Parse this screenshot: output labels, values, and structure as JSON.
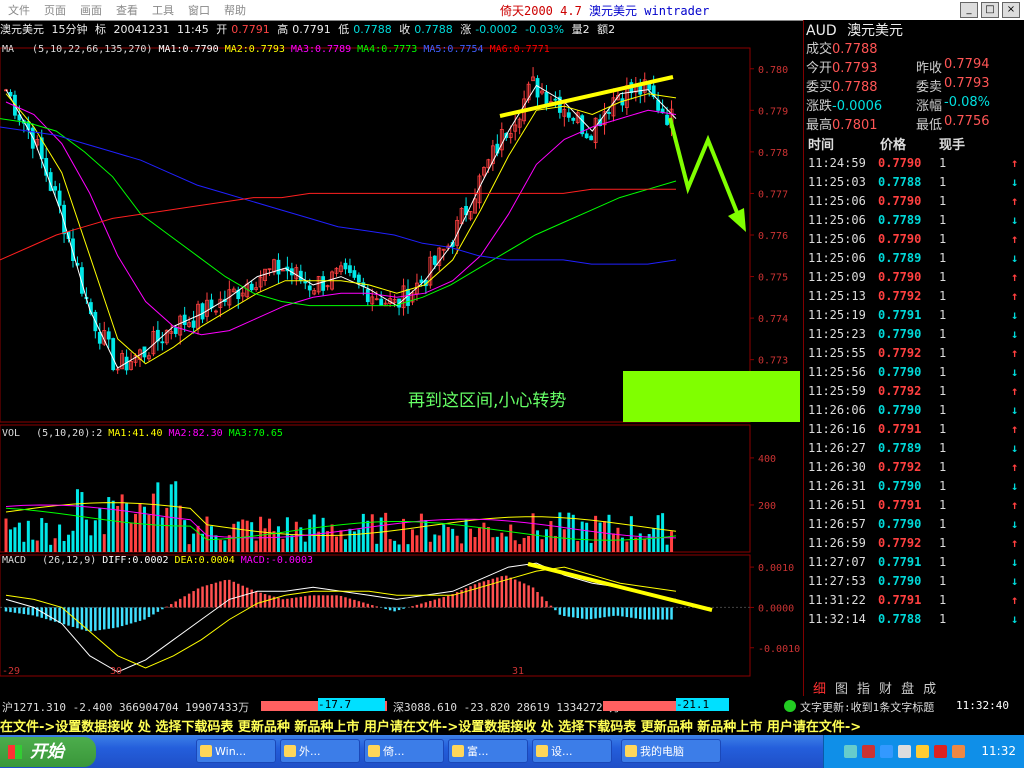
{
  "menu": [
    "文件",
    "页面",
    "画面",
    "查看",
    "工具",
    "窗口",
    "帮助"
  ],
  "app_title": "倚天2000 4.7",
  "app_subtitle": "澳元美元 wintrader",
  "window_controls": [
    "_",
    "□",
    "×"
  ],
  "header": {
    "symbol": "澳元美元",
    "period": "15分钟",
    "mark": "标",
    "date": "20041231",
    "time": "11:45",
    "open_label": "开",
    "open": "0.7791",
    "high_label": "高",
    "high": "0.7791",
    "low_label": "低",
    "low": "0.7788",
    "close_label": "收",
    "close": "0.7788",
    "change_label": "涨",
    "change": "-0.0002",
    "change_pct": "-0.03%",
    "vol": "量2",
    "amt": "额2"
  },
  "ma_legend": {
    "label": "MA",
    "params": "(5,10,22,66,135,270)",
    "items": [
      {
        "name": "MA1:0.7790",
        "color": "#ffffff"
      },
      {
        "name": "MA2:0.7793",
        "color": "#ffff00"
      },
      {
        "name": "MA3:0.7789",
        "color": "#ff00ff"
      },
      {
        "name": "MA4:0.7773",
        "color": "#00ff00"
      },
      {
        "name": "MA5:0.7754",
        "color": "#0000ff"
      },
      {
        "name": "MA6:0.7771",
        "color": "#ff0000"
      }
    ]
  },
  "vol_legend": {
    "label": "VOL",
    "params": "(5,10,20)",
    "value": ":2",
    "items": [
      {
        "name": "MA1:41.40",
        "color": "#ffff00"
      },
      {
        "name": "MA2:82.30",
        "color": "#ff00ff"
      },
      {
        "name": "MA3:70.65",
        "color": "#00ff00"
      }
    ]
  },
  "macd_legend": {
    "label": "MACD",
    "params": "(26,12,9)",
    "items": [
      {
        "name": "DIFF:0.0002",
        "color": "#ffffff"
      },
      {
        "name": "DEA:0.0004",
        "color": "#ffff00"
      },
      {
        "name": "MACD:-0.0003",
        "color": "#ff00ff"
      }
    ]
  },
  "annotation_text": "再到这区间,小心转势",
  "chart_data": [
    {
      "type": "candlestick",
      "title": "澳元美元 15分钟",
      "y_ticks": [
        "0.780",
        "0.779",
        "0.778",
        "0.777",
        "0.776",
        "0.775",
        "0.774",
        "0.773",
        "0.772"
      ],
      "ylim": [
        0.7715,
        0.7805
      ],
      "x_labels": [
        "-29",
        "30",
        "31"
      ],
      "series": [
        {
          "name": "MA1",
          "values": [
            0.7795,
            0.7783,
            0.7765,
            0.7742,
            0.7728,
            0.7732,
            0.7738,
            0.7741,
            0.7745,
            0.775,
            0.7752,
            0.7748,
            0.775,
            0.7747,
            0.7743,
            0.7749,
            0.7758,
            0.7772,
            0.7785,
            0.7796,
            0.7792,
            0.7785,
            0.7794,
            0.7795,
            0.7788
          ]
        },
        {
          "name": "MA2",
          "values": [
            0.7794,
            0.7786,
            0.7775,
            0.7755,
            0.7735,
            0.7729,
            0.7733,
            0.7738,
            0.7742,
            0.7746,
            0.7749,
            0.7749,
            0.7749,
            0.7748,
            0.7746,
            0.7748,
            0.7754,
            0.7766,
            0.7779,
            0.779,
            0.7791,
            0.7789,
            0.7792,
            0.7794,
            0.7793
          ]
        },
        {
          "name": "MA3",
          "values": [
            0.7792,
            0.7789,
            0.7782,
            0.777,
            0.7755,
            0.7744,
            0.7738,
            0.7736,
            0.7737,
            0.774,
            0.7743,
            0.7745,
            0.7746,
            0.7746,
            0.7745,
            0.7746,
            0.7749,
            0.7755,
            0.7765,
            0.7777,
            0.7783,
            0.7786,
            0.7788,
            0.779,
            0.7789
          ]
        },
        {
          "name": "MA4",
          "values": [
            0.7788,
            0.7787,
            0.7785,
            0.778,
            0.7774,
            0.7765,
            0.776,
            0.7755,
            0.775,
            0.7746,
            0.7744,
            0.7743,
            0.7743,
            0.7743,
            0.7743,
            0.7745,
            0.7748,
            0.7752,
            0.7756,
            0.776,
            0.7763,
            0.7766,
            0.7769,
            0.7771,
            0.7773
          ]
        },
        {
          "name": "MA5",
          "values": [
            0.7786,
            0.7785,
            0.7784,
            0.7782,
            0.778,
            0.7778,
            0.7775,
            0.7772,
            0.777,
            0.7768,
            0.7766,
            0.7764,
            0.7762,
            0.7761,
            0.776,
            0.7758,
            0.7757,
            0.7755,
            0.7754,
            0.7754,
            0.7754,
            0.7753,
            0.7753,
            0.7753,
            0.7754
          ]
        },
        {
          "name": "MA6",
          "values": [
            0.7754,
            0.7757,
            0.776,
            0.7762,
            0.7764,
            0.7765,
            0.7766,
            0.7767,
            0.7768,
            0.7769,
            0.7769,
            0.777,
            0.777,
            0.777,
            0.777,
            0.777,
            0.777,
            0.777,
            0.777,
            0.777,
            0.777,
            0.7771,
            0.7771,
            0.7771,
            0.7771
          ]
        }
      ]
    },
    {
      "type": "bar",
      "title": "VOL",
      "y_ticks": [
        "400",
        "200"
      ],
      "ylim": [
        0,
        540
      ]
    },
    {
      "type": "bar",
      "title": "MACD",
      "y_ticks": [
        "0.0010",
        "0.0000",
        "-0.0010"
      ],
      "ylim": [
        -0.0017,
        0.0013
      ],
      "series": [
        {
          "name": "MACD",
          "values": [
            -0.0001,
            -0.0002,
            -0.0004,
            -0.0006,
            -0.0005,
            -0.0003,
            0.0001,
            0.0005,
            0.0007,
            0.0004,
            0.0002,
            0.0003,
            0.0003,
            0.0001,
            -0.0001,
            0.0001,
            0.0003,
            0.0006,
            0.0008,
            0.0005,
            -0.0002,
            -0.0003,
            -0.0002,
            -0.0003,
            -0.0003
          ]
        },
        {
          "name": "DIFF",
          "values": [
            0.0002,
            0.0,
            -0.0004,
            -0.0012,
            -0.0016,
            -0.0013,
            -0.0008,
            -0.0003,
            0.0002,
            0.0004,
            0.0004,
            0.0005,
            0.0004,
            0.0003,
            0.0002,
            0.0003,
            0.0004,
            0.0007,
            0.001,
            0.0011,
            0.0008,
            0.0006,
            0.0005,
            0.0003,
            0.0002
          ]
        },
        {
          "name": "DEA",
          "values": [
            0.0003,
            0.0002,
            0.0,
            -0.0006,
            -0.0012,
            -0.0015,
            -0.0012,
            -0.0008,
            -0.0003,
            0.0001,
            0.0003,
            0.0004,
            0.0004,
            0.0004,
            0.0003,
            0.0003,
            0.0003,
            0.0005,
            0.0007,
            0.0009,
            0.001,
            0.0008,
            0.0006,
            0.0005,
            0.0004
          ]
        }
      ]
    }
  ],
  "quote": {
    "title_code": "AUD",
    "title_name": "澳元美元",
    "rows": [
      {
        "label": "成交",
        "value": "0.7788"
      },
      {
        "label": "今开",
        "value": "0.7793",
        "label2": "昨收",
        "value2": "0.7794"
      },
      {
        "label": "委买",
        "value": "0.7788",
        "label2": "委卖",
        "value2": "0.7793"
      },
      {
        "label": "涨跌",
        "value": "-0.0006",
        "label2": "涨幅",
        "value2": "-0.08%"
      },
      {
        "label": "最高",
        "value": "0.7801",
        "label2": "最低",
        "value2": "0.7756"
      }
    ]
  },
  "ticks_header": {
    "time": "时间",
    "price": "价格",
    "vol": "现手"
  },
  "ticks": [
    {
      "time": "11:24:59",
      "price": "0.7790",
      "vol": "1",
      "dir": "up"
    },
    {
      "time": "11:25:03",
      "price": "0.7788",
      "vol": "1",
      "dir": "down"
    },
    {
      "time": "11:25:06",
      "price": "0.7790",
      "vol": "1",
      "dir": "up"
    },
    {
      "time": "11:25:06",
      "price": "0.7789",
      "vol": "1",
      "dir": "down"
    },
    {
      "time": "11:25:06",
      "price": "0.7790",
      "vol": "1",
      "dir": "up"
    },
    {
      "time": "11:25:06",
      "price": "0.7789",
      "vol": "1",
      "dir": "down"
    },
    {
      "time": "11:25:09",
      "price": "0.7790",
      "vol": "1",
      "dir": "up"
    },
    {
      "time": "11:25:13",
      "price": "0.7792",
      "vol": "1",
      "dir": "up"
    },
    {
      "time": "11:25:19",
      "price": "0.7791",
      "vol": "1",
      "dir": "down"
    },
    {
      "time": "11:25:23",
      "price": "0.7790",
      "vol": "1",
      "dir": "down"
    },
    {
      "time": "11:25:55",
      "price": "0.7792",
      "vol": "1",
      "dir": "up"
    },
    {
      "time": "11:25:56",
      "price": "0.7790",
      "vol": "1",
      "dir": "down"
    },
    {
      "time": "11:25:59",
      "price": "0.7792",
      "vol": "1",
      "dir": "up"
    },
    {
      "time": "11:26:06",
      "price": "0.7790",
      "vol": "1",
      "dir": "down"
    },
    {
      "time": "11:26:16",
      "price": "0.7791",
      "vol": "1",
      "dir": "up"
    },
    {
      "time": "11:26:27",
      "price": "0.7789",
      "vol": "1",
      "dir": "down"
    },
    {
      "time": "11:26:30",
      "price": "0.7792",
      "vol": "1",
      "dir": "up"
    },
    {
      "time": "11:26:31",
      "price": "0.7790",
      "vol": "1",
      "dir": "down"
    },
    {
      "time": "11:26:51",
      "price": "0.7791",
      "vol": "1",
      "dir": "up"
    },
    {
      "time": "11:26:57",
      "price": "0.7790",
      "vol": "1",
      "dir": "down"
    },
    {
      "time": "11:26:59",
      "price": "0.7792",
      "vol": "1",
      "dir": "up"
    },
    {
      "time": "11:27:07",
      "price": "0.7791",
      "vol": "1",
      "dir": "down"
    },
    {
      "time": "11:27:53",
      "price": "0.7790",
      "vol": "1",
      "dir": "down"
    },
    {
      "time": "11:31:22",
      "price": "0.7791",
      "vol": "1",
      "dir": "up"
    },
    {
      "time": "11:32:14",
      "price": "0.7788",
      "vol": "1",
      "dir": "down"
    }
  ],
  "panel_tabs": [
    "细",
    "图",
    "指",
    "财",
    "盘",
    "成"
  ],
  "status": {
    "sh": "沪1271.310 -2.400 366904704 19907433万",
    "sh_bar": "-17.7",
    "sz": "深3088.610 -23.820 28619 13342723万",
    "sz_bar": "-21.1",
    "msg": "文字更新:收到1条文字标题",
    "time": "11:32:40"
  },
  "ticker_text": "在文件->设置数据接收 处  选择下载码表 更新品种   新品种上市 用户请在文件->设置数据接收 处  选择下载码表 更新品种   新品种上市 用户请在文件->",
  "taskbar": {
    "start": "开始",
    "tasks": [
      "Win...",
      "外...",
      "倚...",
      "富...",
      "设...",
      "文...",
      "我的电脑"
    ],
    "clock": "11:32"
  },
  "colors": {
    "up": "#ff4040",
    "down": "#00d8d8",
    "grid": "#8b0000",
    "annotation": "#80ff00",
    "trend": "#ffff00"
  }
}
